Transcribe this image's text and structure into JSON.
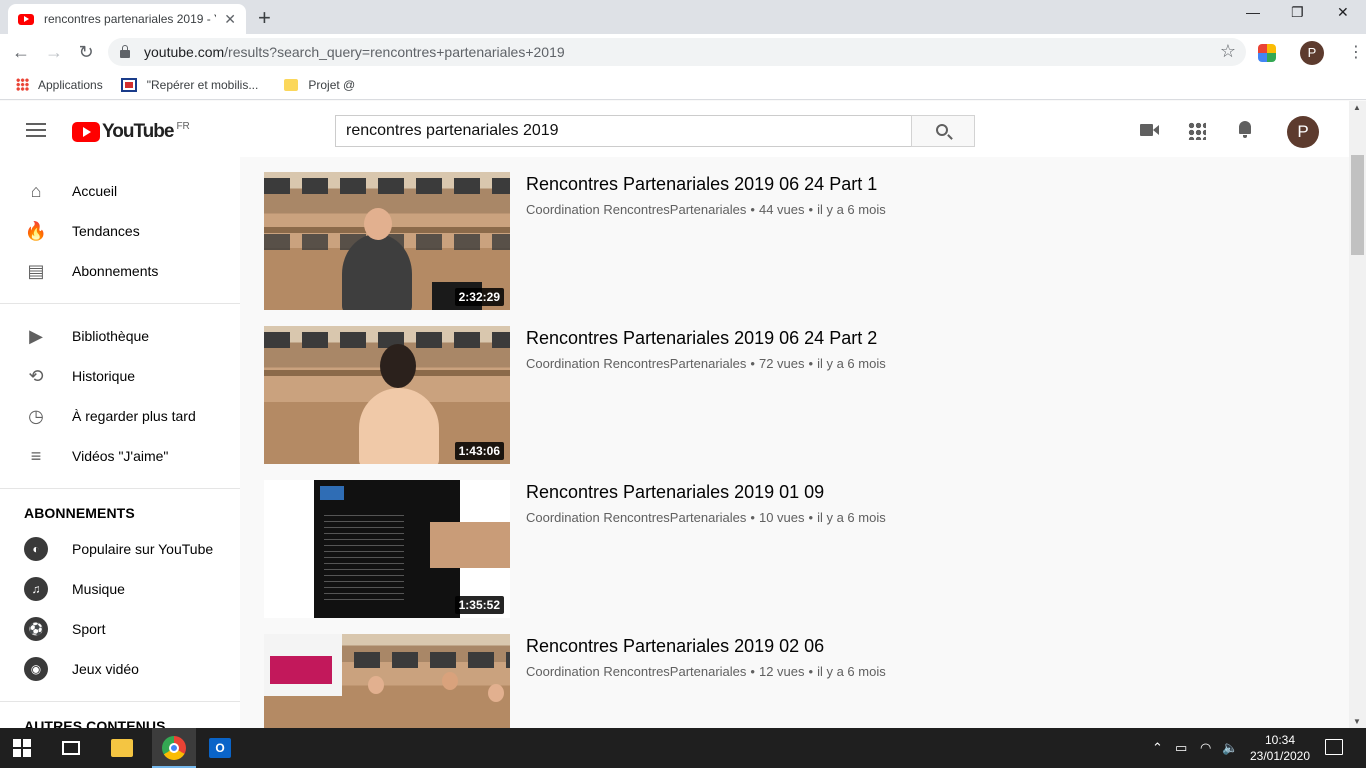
{
  "browser": {
    "tab_title": "rencontres partenariales 2019 - Y",
    "tab_close": "✕",
    "new_tab": "+",
    "win_min": "—",
    "win_restore": "❐",
    "win_close": "✕",
    "back": "←",
    "forward": "→",
    "reload": "↻",
    "url_host": "youtube.com",
    "url_path": "/results?search_query=rencontres+partenariales+2019",
    "star": "☆",
    "profile_letter": "P",
    "menu": "⋮"
  },
  "bookmarks": [
    {
      "label": "Applications"
    },
    {
      "label": "\"Repérer et mobilis..."
    },
    {
      "label": "Projet @"
    }
  ],
  "youtube": {
    "logo_text": "YouTube",
    "country": "FR",
    "search_value": "rencontres partenariales 2019",
    "avatar_letter": "P"
  },
  "sidebar": {
    "main": [
      {
        "label": "Accueil",
        "icon": "⌂"
      },
      {
        "label": "Tendances",
        "icon": "🔥"
      },
      {
        "label": "Abonnements",
        "icon": "▤"
      }
    ],
    "library": [
      {
        "label": "Bibliothèque",
        "icon": "▶"
      },
      {
        "label": "Historique",
        "icon": "⟲"
      },
      {
        "label": "À regarder plus tard",
        "icon": "◷"
      },
      {
        "label": "Vidéos \"J'aime\"",
        "icon": "≡"
      }
    ],
    "subscriptions_heading": "ABONNEMENTS",
    "subscriptions": [
      {
        "label": "Populaire sur YouTube",
        "icon": "◐"
      },
      {
        "label": "Musique",
        "icon": "♫"
      },
      {
        "label": "Sport",
        "icon": "⚽"
      },
      {
        "label": "Jeux vidéo",
        "icon": "◉"
      }
    ],
    "more_heading": "AUTRES CONTENUS"
  },
  "results": [
    {
      "title": "Rencontres Partenariales 2019 06 24 Part 1",
      "channel": "Coordination RencontresPartenariales",
      "views": "44 vues",
      "age": "il y a 6 mois",
      "duration": "2:32:29"
    },
    {
      "title": "Rencontres Partenariales 2019 06 24 Part 2",
      "channel": "Coordination RencontresPartenariales",
      "views": "72 vues",
      "age": "il y a 6 mois",
      "duration": "1:43:06"
    },
    {
      "title": "Rencontres Partenariales 2019 01 09",
      "channel": "Coordination RencontresPartenariales",
      "views": "10 vues",
      "age": "il y a 6 mois",
      "duration": "1:35:52"
    },
    {
      "title": "Rencontres Partenariales 2019 02 06",
      "channel": "Coordination RencontresPartenariales",
      "views": "12 vues",
      "age": "il y a 6 mois",
      "duration": ""
    }
  ],
  "separator": "•",
  "taskbar": {
    "time": "10:34",
    "date": "23/01/2020",
    "outlook_letter": "O"
  },
  "colors": {
    "yt_red": "#ff0000",
    "avatar_brown": "#5d3b2e",
    "taskbar": "#1f1f1f"
  }
}
